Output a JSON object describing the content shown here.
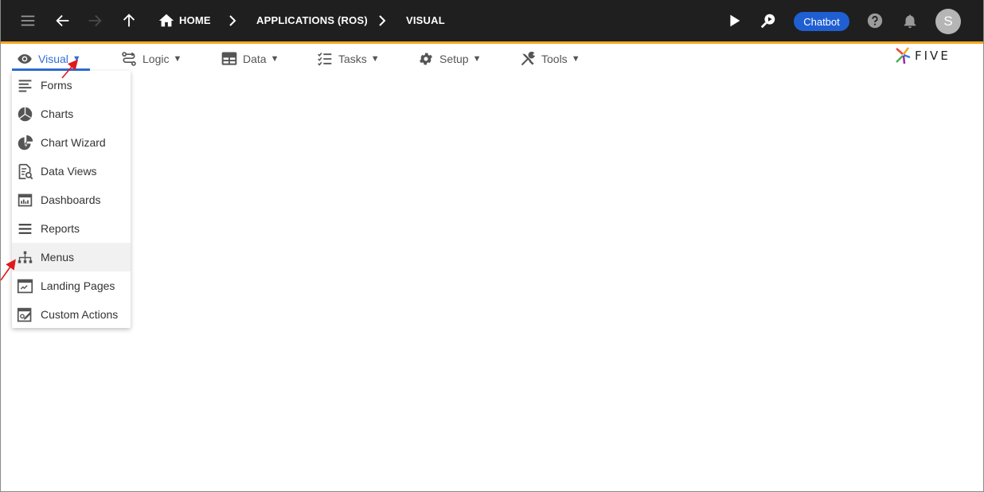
{
  "topbar": {
    "breadcrumbs": [
      "HOME",
      "APPLICATIONS (ROS)",
      "VISUAL"
    ],
    "chatbot_label": "Chatbot",
    "avatar_initial": "S",
    "accent_color": "#f5a623",
    "background_color": "#1f1f1f"
  },
  "menubar": {
    "items": [
      {
        "label": "Visual",
        "icon": "eye-icon",
        "active": true
      },
      {
        "label": "Logic",
        "icon": "logic-icon",
        "active": false
      },
      {
        "label": "Data",
        "icon": "table-icon",
        "active": false
      },
      {
        "label": "Tasks",
        "icon": "checklist-icon",
        "active": false
      },
      {
        "label": "Setup",
        "icon": "gear-icon",
        "active": false
      },
      {
        "label": "Tools",
        "icon": "tools-icon",
        "active": false
      }
    ],
    "caret": "▼",
    "active_color": "#2f6fd6"
  },
  "logo": {
    "text": "FIVE"
  },
  "dropdown": {
    "items": [
      {
        "label": "Forms",
        "icon": "forms-icon"
      },
      {
        "label": "Charts",
        "icon": "pie-chart-icon"
      },
      {
        "label": "Chart Wizard",
        "icon": "chart-wizard-icon"
      },
      {
        "label": "Data Views",
        "icon": "data-view-icon"
      },
      {
        "label": "Dashboards",
        "icon": "dashboard-icon"
      },
      {
        "label": "Reports",
        "icon": "reports-icon"
      },
      {
        "label": "Menus",
        "icon": "sitemap-icon",
        "highlighted": true
      },
      {
        "label": "Landing Pages",
        "icon": "landing-page-icon"
      },
      {
        "label": "Custom Actions",
        "icon": "custom-actions-icon"
      }
    ]
  },
  "annotation_color": "#e0191b"
}
